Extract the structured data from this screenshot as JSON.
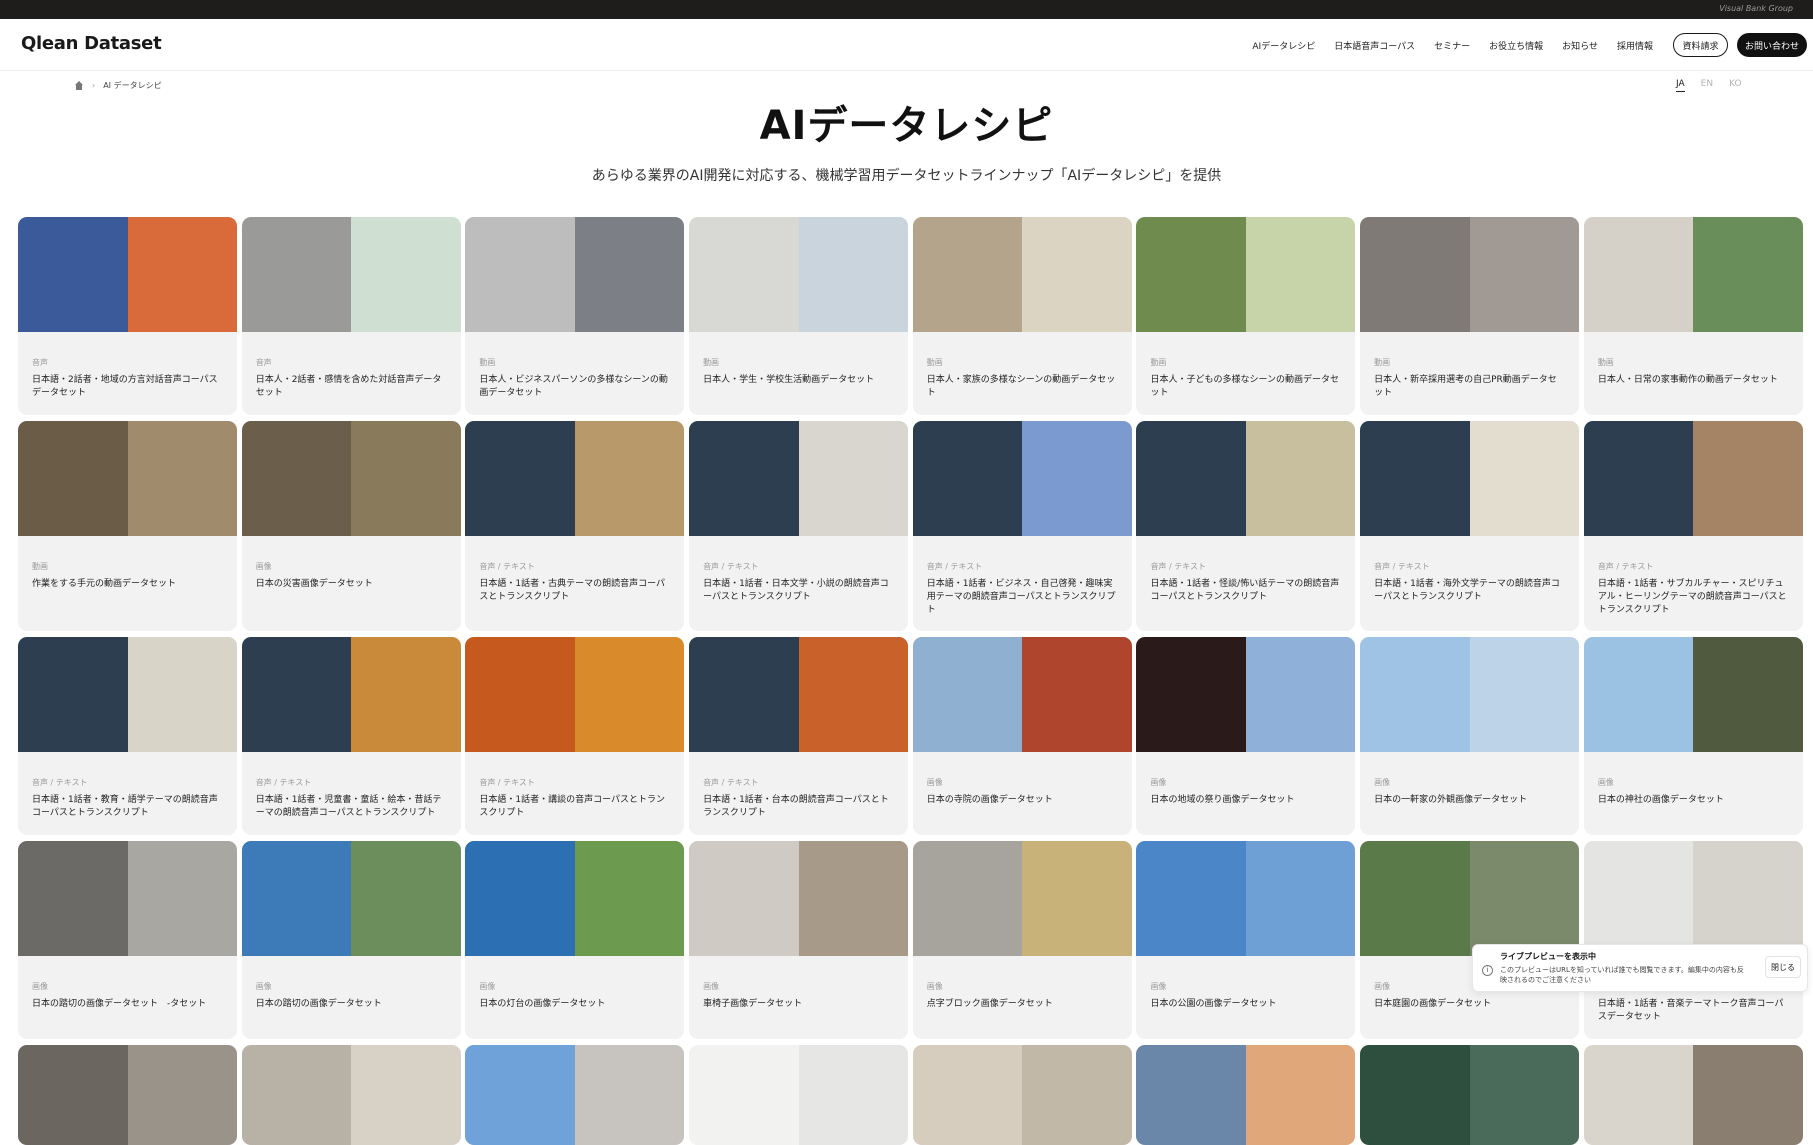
{
  "topbar": {
    "group_label": "Visual Bank Group"
  },
  "header": {
    "logo": "Qlean Dataset",
    "nav": [
      "AIデータレシピ",
      "日本語音声コーパス",
      "セミナー",
      "お役立ち情報",
      "お知らせ",
      "採用情報"
    ],
    "request_docs": "資料請求",
    "contact": "お問い合わせ"
  },
  "breadcrumb": {
    "current": "AI データレシピ"
  },
  "languages": {
    "ja": "JA",
    "en": "EN",
    "ko": "KO"
  },
  "page": {
    "title": "AIデータレシピ",
    "subtitle": "あらゆる業界のAI開発に対応する、機械学習用データセットラインナップ「AIデータレシピ」を提供"
  },
  "cards": [
    {
      "tag": "音声",
      "title": "日本語・2話者・地域の方言対話音声コーパスデータセット",
      "colors": [
        "#3a5a9a",
        "#d96a3a"
      ]
    },
    {
      "tag": "音声",
      "title": "日本人・2話者・感情を含めた対話音声データセット",
      "colors": [
        "#9a9a98",
        "#cfe0d2"
      ]
    },
    {
      "tag": "動画",
      "title": "日本人・ビジネスパーソンの多様なシーンの動画データセット",
      "colors": [
        "#bdbdbd",
        "#7c7f86"
      ]
    },
    {
      "tag": "動画",
      "title": "日本人・学生・学校生活動画データセット",
      "colors": [
        "#d8d8d4",
        "#c9d4dc"
      ]
    },
    {
      "tag": "動画",
      "title": "日本人・家族の多様なシーンの動画データセット",
      "colors": [
        "#b5a48c",
        "#dcd4c2"
      ]
    },
    {
      "tag": "動画",
      "title": "日本人・子どもの多様なシーンの動画データセット",
      "colors": [
        "#6f8c4e",
        "#c7d4aa"
      ]
    },
    {
      "tag": "動画",
      "title": "日本人・新卒採用選考の自己PR動画データセット",
      "colors": [
        "#7f7a76",
        "#a19a94"
      ]
    },
    {
      "tag": "動画",
      "title": "日本人・日常の家事動作の動画データセット",
      "colors": [
        "#d6d1c8",
        "#6a8e5a"
      ]
    },
    {
      "tag": "動画",
      "title": "作業をする手元の動画データセット",
      "colors": [
        "#6a5c46",
        "#a08b6c"
      ]
    },
    {
      "tag": "画像",
      "title": "日本の災害画像データセット",
      "colors": [
        "#6b5e4b",
        "#8a7a5c"
      ]
    },
    {
      "tag": "音声 / テキスト",
      "title": "日本語・1話者・古典テーマの朗読音声コーパスとトランスクリプト",
      "colors": [
        "#2c3e50",
        "#b89a6a"
      ]
    },
    {
      "tag": "音声 / テキスト",
      "title": "日本語・1話者・日本文学・小説の朗読音声コーパスとトランスクリプト",
      "colors": [
        "#2c3e50",
        "#d9d6cf"
      ]
    },
    {
      "tag": "音声 / テキスト",
      "title": "日本語・1話者・ビジネス・自己啓発・趣味実用テーマの朗読音声コーパスとトランスクリプト",
      "colors": [
        "#2c3e50",
        "#7a9ad0"
      ]
    },
    {
      "tag": "音声 / テキスト",
      "title": "日本語・1話者・怪談/怖い話テーマの朗読音声コーパスとトランスクリプト",
      "colors": [
        "#2c3e50",
        "#c8bf9e"
      ]
    },
    {
      "tag": "音声 / テキスト",
      "title": "日本語・1話者・海外文学テーマの朗読音声コーパスとトランスクリプト",
      "colors": [
        "#2c3e50",
        "#e3ddd0"
      ]
    },
    {
      "tag": "音声 / テキスト",
      "title": "日本語・1話者・サブカルチャー・スピリチュアル・ヒーリングテーマの朗読音声コーパスとトランスクリプト",
      "colors": [
        "#2c3e50",
        "#a48464"
      ]
    },
    {
      "tag": "音声 / テキスト",
      "title": "日本語・1話者・教育・語学テーマの朗読音声コーパスとトランスクリプト",
      "colors": [
        "#2c3e50",
        "#d9d4c8"
      ]
    },
    {
      "tag": "音声 / テキスト",
      "title": "日本語・1話者・児童書・童話・絵本・昔話テーマの朗読音声コーパスとトランスクリプト",
      "colors": [
        "#2c3e50",
        "#c98a3a"
      ]
    },
    {
      "tag": "音声 / テキスト",
      "title": "日本語・1話者・講談の音声コーパスとトランスクリプト",
      "colors": [
        "#c65a1e",
        "#d98a2a"
      ]
    },
    {
      "tag": "音声 / テキスト",
      "title": "日本語・1話者・台本の朗読音声コーパスとトランスクリプト",
      "colors": [
        "#2c3e50",
        "#c8612a"
      ]
    },
    {
      "tag": "画像",
      "title": "日本の寺院の画像データセット",
      "colors": [
        "#8fb0d0",
        "#b0452e"
      ]
    },
    {
      "tag": "画像",
      "title": "日本の地域の祭り画像データセット",
      "colors": [
        "#2a1a1a",
        "#8fb0d8"
      ]
    },
    {
      "tag": "画像",
      "title": "日本の一軒家の外観画像データセット",
      "colors": [
        "#9ec3e4",
        "#bcd3e8"
      ]
    },
    {
      "tag": "画像",
      "title": "日本の神社の画像データセット",
      "colors": [
        "#9cc2e3",
        "#4f5a3e"
      ]
    },
    {
      "tag": "画像",
      "title": "日本の踏切の画像データセット　-タセット",
      "colors": [
        "#6b6a66",
        "#a8a7a2"
      ]
    },
    {
      "tag": "画像",
      "title": "日本の踏切の画像データセット",
      "colors": [
        "#3c7ab8",
        "#6b8e5c"
      ]
    },
    {
      "tag": "画像",
      "title": "日本の灯台の画像データセット",
      "colors": [
        "#2d6fb3",
        "#6c9a4e"
      ]
    },
    {
      "tag": "画像",
      "title": "車椅子画像データセット",
      "colors": [
        "#cfcac4",
        "#a89a88"
      ]
    },
    {
      "tag": "画像",
      "title": "点字ブロック画像データセット",
      "colors": [
        "#a6a49c",
        "#c9b27a"
      ]
    },
    {
      "tag": "画像",
      "title": "日本の公園の画像データセット",
      "colors": [
        "#4a86c8",
        "#6ea0d6"
      ]
    },
    {
      "tag": "画像",
      "title": "日本庭園の画像データセット",
      "colors": [
        "#5a7a4a",
        "#7a8a6a"
      ]
    },
    {
      "tag": "",
      "title": "日本語・1話者・音楽テーマトーク音声コーパスデータセット",
      "colors": [
        "#e4e4e2",
        "#d6d2cc"
      ]
    },
    {
      "tag": "",
      "title": "",
      "colors": [
        "#6b6660",
        "#9a938a"
      ]
    },
    {
      "tag": "",
      "title": "",
      "colors": [
        "#b8b2a6",
        "#d8d2c6"
      ]
    },
    {
      "tag": "",
      "title": "",
      "colors": [
        "#6fa2d8",
        "#c7c4c0"
      ]
    },
    {
      "tag": "",
      "title": "",
      "colors": [
        "#f2f2f0",
        "#e6e6e4"
      ]
    },
    {
      "tag": "",
      "title": "",
      "colors": [
        "#d6cdbf",
        "#c2b8a8"
      ]
    },
    {
      "tag": "",
      "title": "",
      "colors": [
        "#6a86a8",
        "#e0a87a"
      ]
    },
    {
      "tag": "",
      "title": "",
      "colors": [
        "#2f4f3e",
        "#4a6b5a"
      ]
    },
    {
      "tag": "",
      "title": "",
      "colors": [
        "#d9d4cc",
        "#8a7e70"
      ]
    }
  ],
  "toast": {
    "title": "ライブプレビューを表示中",
    "body": "このプレビューはURLを知っていれば誰でも閲覧できます。編集中の内容も反映されるのでご注意ください",
    "close": "閉じる"
  }
}
